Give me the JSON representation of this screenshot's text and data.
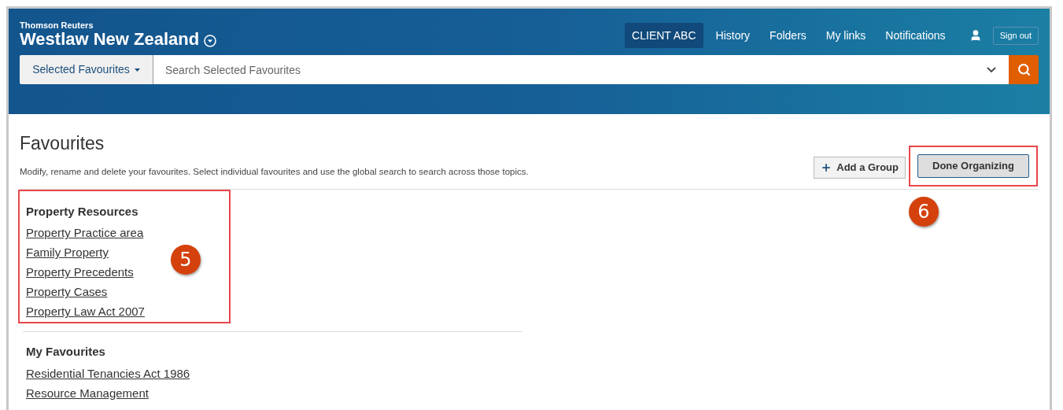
{
  "brand": {
    "company": "Thomson Reuters",
    "product": "Westlaw New Zealand"
  },
  "nav": [
    {
      "label": "CLIENT ABC",
      "selected": true
    },
    {
      "label": "History",
      "selected": false
    },
    {
      "label": "Folders",
      "selected": false
    },
    {
      "label": "My links",
      "selected": false
    },
    {
      "label": "Notifications",
      "selected": false
    }
  ],
  "sign_out": "Sign out",
  "search": {
    "scope": "Selected Favourites",
    "placeholder": "Search Selected Favourites"
  },
  "page": {
    "title": "Favourites",
    "description": "Modify, rename and delete your favourites. Select individual favourites and use the global search to search across those topics."
  },
  "buttons": [
    {
      "label": "Add a Group",
      "kind": "add",
      "highlighted": false
    },
    {
      "label": "Done Organizing",
      "kind": "primary",
      "highlighted": true,
      "callout": "6"
    }
  ],
  "groups": [
    {
      "title": "Property Resources",
      "highlighted": true,
      "callout": "5",
      "items": [
        "Property Practice area",
        "Family Property",
        "Property Precedents",
        "Property Cases",
        "Property Law Act 2007"
      ]
    },
    {
      "title": "My Favourites",
      "highlighted": false,
      "items": [
        "Residential Tenancies Act 1986",
        "Resource Management"
      ]
    }
  ]
}
